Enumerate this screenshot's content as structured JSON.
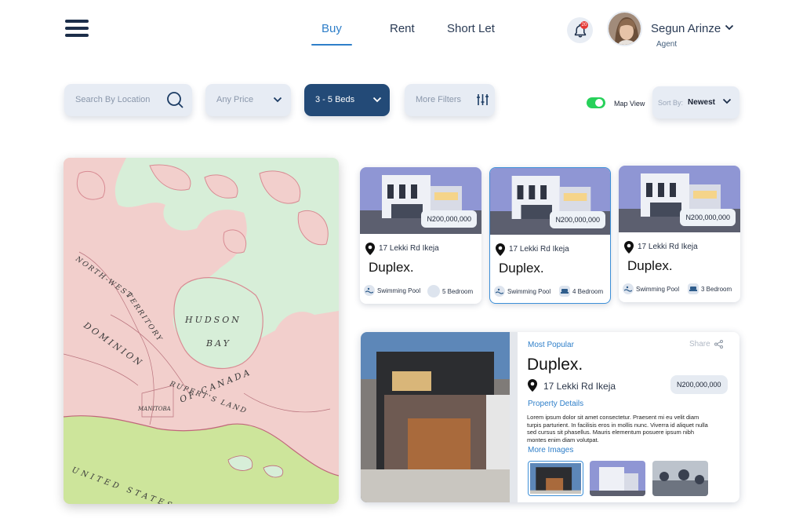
{
  "nav": {
    "tabs": [
      {
        "label": "Buy",
        "active": true
      },
      {
        "label": "Rent",
        "active": false
      },
      {
        "label": "Short Let",
        "active": false
      }
    ],
    "notification_count": "20",
    "user": {
      "name": "Segun Arinze",
      "role": "Agent"
    }
  },
  "filters": {
    "search_placeholder": "Search By Location",
    "price": "Any Price",
    "beds": "3 - 5 Beds",
    "more": "More Filters",
    "map_view_label": "Map View",
    "map_view_on": true,
    "sort_label": "Sort By:",
    "sort_value": "Newest"
  },
  "map": {
    "labels": [
      "HUDSON",
      "BAY",
      "MANITOBA",
      "NORTH-WEST",
      "TERRITORY",
      "DOMINION",
      "RUPERT'S LAND",
      "OF CANADA",
      "UNITED STATES"
    ]
  },
  "listings": [
    {
      "price": "N200,000,000",
      "address": "17 Lekki Rd Ikeja",
      "title": "Duplex.",
      "feature": "Swimming Pool",
      "bedrooms": "5 Bedroom",
      "selected": false
    },
    {
      "price": "N200,000,000",
      "address": "17 Lekki Rd Ikeja",
      "title": "Duplex.",
      "feature": "Swimming Pool",
      "bedrooms": "4 Bedroom",
      "selected": true
    },
    {
      "price": "N200,000,000",
      "address": "17 Lekki Rd Ikeja",
      "title": "Duplex.",
      "feature": "Swimming Pool",
      "bedrooms": "3 Bedroom",
      "selected": false
    }
  ],
  "featured": {
    "tag": "Most Popular",
    "share": "Share",
    "title": "Duplex.",
    "address": "17 Lekki Rd Ikeja",
    "price": "N200,000,000",
    "details_label": "Property Details",
    "description": "Lorem ipsum dolor sit amet consectetur. Praesent mi eu velit diam turpis parturient. In facilisis eros in mollis nunc. Viverra id aliquet nulla sed cursus sit phasellus. Mauris elementum posuere ipsum nibh montes enim diam volutpat.",
    "more_images_label": "More Images"
  },
  "colors": {
    "accent": "#2f7fc9",
    "dark_button": "#234a77",
    "toggle_on": "#27d15a",
    "badge": "#e53935"
  }
}
